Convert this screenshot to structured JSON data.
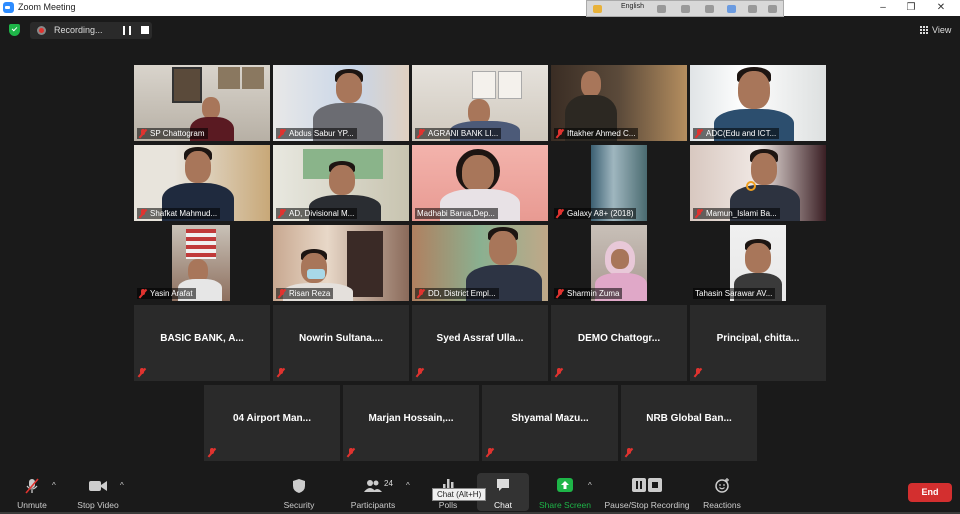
{
  "window": {
    "title": "Zoom Meeting",
    "controls": [
      "–",
      "❐",
      "✕"
    ]
  },
  "topbar": {
    "recording_label": "Recording...",
    "language_label": "English",
    "view_label": "View"
  },
  "colors": {
    "background": "#1a1a1a",
    "active_speaker": "#d1e66b",
    "end_button": "#d32f2f",
    "share_green": "#1eb548",
    "mute_red": "#e0332f"
  },
  "video_tiles": [
    {
      "name": "SP Chattogram"
    },
    {
      "name": "Abdus Sabur  YP..."
    },
    {
      "name": "AGRANI BANK LI..."
    },
    {
      "name": "Iftakher Ahmed C..."
    },
    {
      "name": "ADC(Edu and ICT..."
    },
    {
      "name": "Shafkat Mahmud..."
    },
    {
      "name": "AD, Divisional M..."
    },
    {
      "name": "Madhabi Barua,Dep..."
    },
    {
      "name": "Galaxy A8+ (2018)"
    },
    {
      "name": "Mamun_Islami Ba..."
    },
    {
      "name": "Yasin Arafat"
    },
    {
      "name": "Risan Reza"
    },
    {
      "name": "DD, District Empl..."
    },
    {
      "name": "Sharmin Zuma"
    },
    {
      "name": "Tahasin Sarawar AV..."
    }
  ],
  "name_tiles": [
    {
      "name": "BASIC BANK, A..."
    },
    {
      "name": "Nowrin  Sultana...."
    },
    {
      "name": "Syed Assraf Ulla..."
    },
    {
      "name": "DEMO  Chattogr..."
    },
    {
      "name": "Principal,  chitta..."
    },
    {
      "name": "04  Airport Man..."
    },
    {
      "name": "Marjan  Hossain,..."
    },
    {
      "name": "Shyamal  Mazu..."
    },
    {
      "name": "NRB Global Ban..."
    }
  ],
  "toolbar": {
    "unmute": "Unmute",
    "stop_video": "Stop Video",
    "security": "Security",
    "participants": "Participants",
    "participants_count": "24",
    "polls": "Polls",
    "chat": "Chat",
    "share_screen": "Share Screen",
    "pause_stop_recording": "Pause/Stop Recording",
    "reactions": "Reactions",
    "end": "End",
    "tooltip": "Chat (Alt+H)"
  }
}
